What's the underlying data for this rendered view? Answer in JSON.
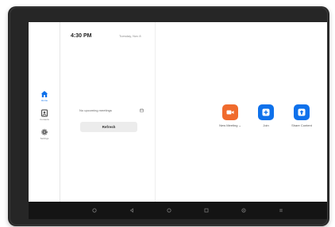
{
  "status": {
    "time": "4:30 PM",
    "date": "Tuesday, Nov 8"
  },
  "sidebar": {
    "items": [
      {
        "label": "Home",
        "icon": "home-icon",
        "active": true
      },
      {
        "label": "Contacts",
        "icon": "contacts-icon",
        "active": false
      },
      {
        "label": "Settings",
        "icon": "gear-icon",
        "active": false
      }
    ]
  },
  "meetings": {
    "empty_text": "No upcoming meetings",
    "refresh_label": "Refresh"
  },
  "actions": [
    {
      "label": "New Meeting ⌄",
      "icon": "video-camera-icon",
      "color": "#f06b2d"
    },
    {
      "label": "Join",
      "icon": "plus-icon",
      "color": "#0e71eb"
    },
    {
      "label": "Share Content",
      "icon": "upload-arrow-icon",
      "color": "#0e71eb"
    }
  ],
  "colors": {
    "accent": "#0e71eb",
    "orange": "#f06b2d",
    "bezel": "#262626"
  }
}
